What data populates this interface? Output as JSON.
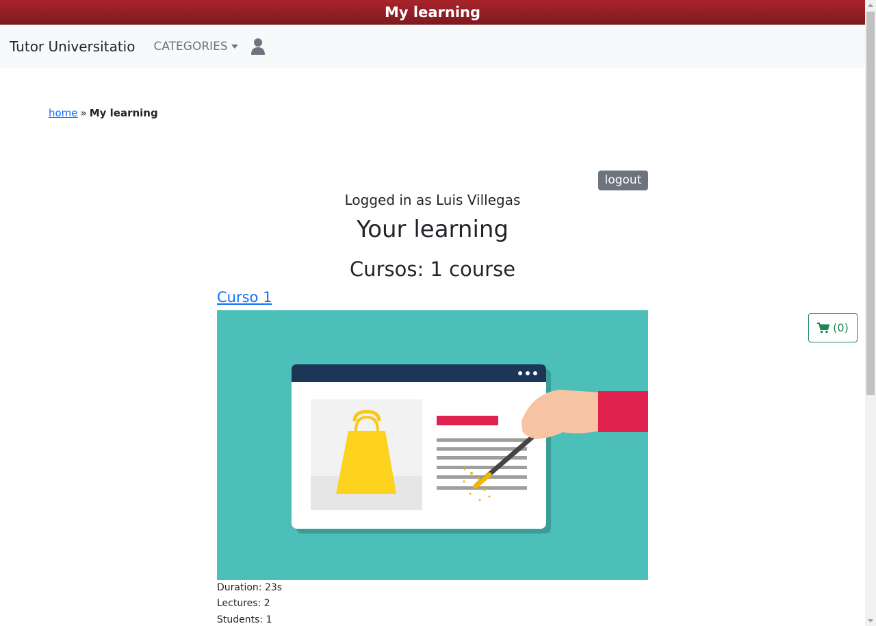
{
  "window": {
    "title": "My learning"
  },
  "navbar": {
    "brand": "Tutor Universitatio",
    "categories_label": "CATEGORIES"
  },
  "breadcrumb": {
    "home": "home",
    "separator": "»",
    "current": "My learning"
  },
  "account": {
    "logout_label": "logout",
    "logged_in_text": "Logged in as Luis Villegas"
  },
  "main": {
    "heading": "Your learning",
    "subheading": "Cursos: 1 course",
    "course": {
      "title": "Curso 1",
      "duration": "Duration: 23s",
      "lectures": "Lectures: 2",
      "students": "Students: 1"
    }
  },
  "cart": {
    "count_label": "(0)"
  },
  "colors": {
    "titlebar": "#8f1f25",
    "link": "#0d6efd",
    "cart": "#198754",
    "logout_bg": "#6c757d",
    "image_bg": "#4bbfb8"
  }
}
